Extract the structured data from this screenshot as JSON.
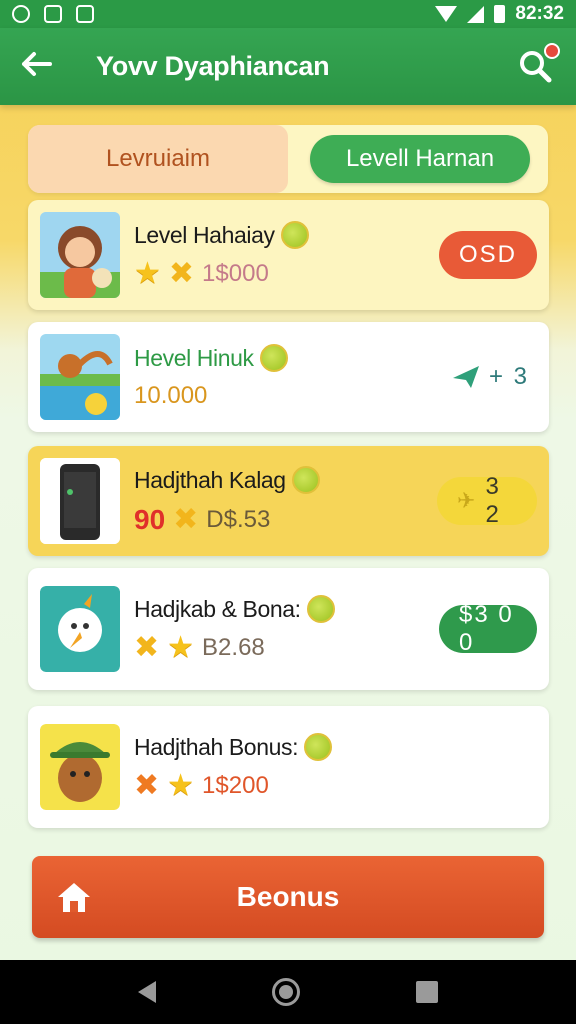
{
  "status_bar": {
    "time": "82:32"
  },
  "app_bar": {
    "title": "Yovv Dyaphiancan"
  },
  "tabs": {
    "left_label": "Levruiaim",
    "right_label": "Levell Harnan"
  },
  "cards": [
    {
      "title": "Level Hahaiay",
      "stat": "1$000",
      "badge": "OSD",
      "badge_color": "#e85a37",
      "bg": "#fdf5c0",
      "title_color": "#1b1b1b",
      "stat_color": "#c46a2a"
    },
    {
      "title": "Hevel Hinuk",
      "stat": "10.000",
      "badge": "+ 3",
      "badge_color": "transparent",
      "bg": "#ffffff",
      "title_color": "#2e9a45",
      "stat_color": "#d9961e"
    },
    {
      "title": "Hadjthah Kalag",
      "stat_prefix": "90",
      "stat": "D$.53",
      "badge": "3 2",
      "badge_color": "#f4d73a",
      "bg": "#f6d558",
      "title_color": "#1b1b1b",
      "stat_color": "#c46a2a"
    },
    {
      "title": "Hadjkab & Bona:",
      "stat": "B2.68",
      "badge": "$3 0 0",
      "badge_color": "#2f9a4c",
      "bg": "#ffffff",
      "title_color": "#1b1b1b",
      "stat_color": "#7a6a5a"
    },
    {
      "title": "Hadjthah Bonus:",
      "stat": "1$200",
      "badge": "",
      "badge_color": "transparent",
      "bg": "#ffffff",
      "title_color": "#1b1b1b",
      "stat_color": "#e0562a"
    }
  ],
  "bonus_button": {
    "label": "Beonus"
  },
  "icons": {
    "back": "arrow-left-icon",
    "search": "search-icon",
    "home": "home-icon",
    "coin": "coin-icon",
    "star": "star-icon"
  }
}
